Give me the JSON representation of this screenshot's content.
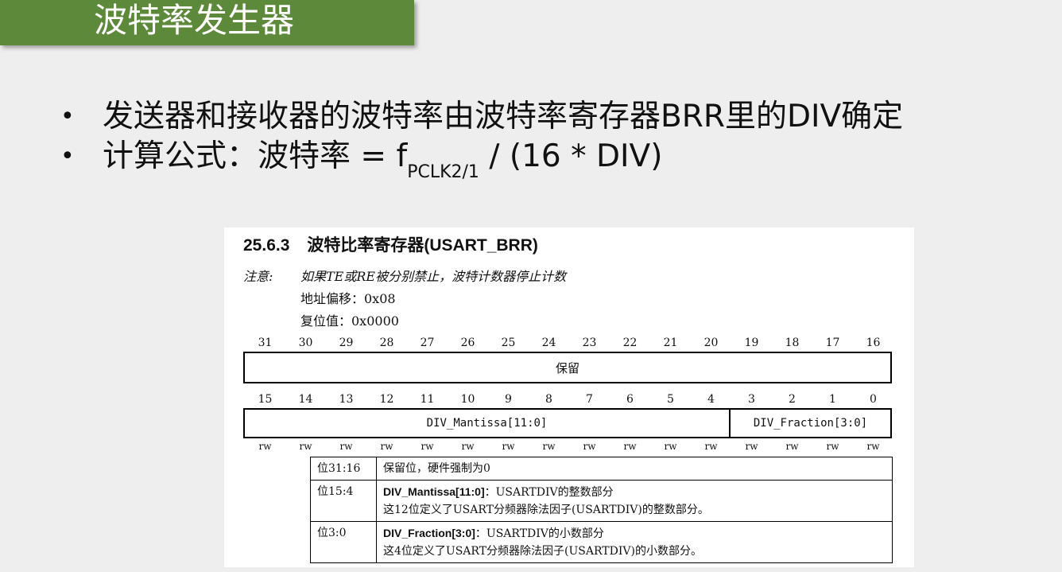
{
  "slide": {
    "title": "波特率发生器",
    "bullets": [
      {
        "text": "发送器和接收器的波特率由波特率寄存器BRR里的DIV确定"
      },
      {
        "prefix": "计算公式：波特率 = f",
        "subscript": "PCLK2/1",
        "suffix": " / (16 * DIV)"
      }
    ]
  },
  "register": {
    "section_number": "25.6.3",
    "section_title": "波特比率寄存器(USART_BRR)",
    "note_label": "注意:",
    "note_text": "如果TE或RE被分别禁止，波特计数器停止计数",
    "address_offset": "地址偏移：0x08",
    "reset_value": "复位值：0x0000",
    "high_bits": [
      "31",
      "30",
      "29",
      "28",
      "27",
      "26",
      "25",
      "24",
      "23",
      "22",
      "21",
      "20",
      "19",
      "18",
      "17",
      "16"
    ],
    "low_bits": [
      "15",
      "14",
      "13",
      "12",
      "11",
      "10",
      "9",
      "8",
      "7",
      "6",
      "5",
      "4",
      "3",
      "2",
      "1",
      "0"
    ],
    "reserved_label": "保留",
    "fields": [
      {
        "name": "DIV_Mantissa[11:0]"
      },
      {
        "name": "DIV_Fraction[3:0]"
      }
    ],
    "access": [
      "rw",
      "rw",
      "rw",
      "rw",
      "rw",
      "rw",
      "rw",
      "rw",
      "rw",
      "rw",
      "rw",
      "rw",
      "rw",
      "rw",
      "rw",
      "rw"
    ],
    "descriptions": [
      {
        "bits": "位31:16",
        "text": "保留位，硬件强制为0"
      },
      {
        "bits": "位15:4",
        "bold": "DIV_Mantissa[11:0]",
        "summary": "：USARTDIV的整数部分",
        "detail": "这12位定义了USART分频器除法因子(USARTDIV)的整数部分。"
      },
      {
        "bits": "位3:0",
        "bold": "DIV_Fraction[3:0]",
        "summary": "：USARTDIV的小数部分",
        "detail": "这4位定义了USART分频器除法因子(USARTDIV)的小数部分。"
      }
    ]
  }
}
